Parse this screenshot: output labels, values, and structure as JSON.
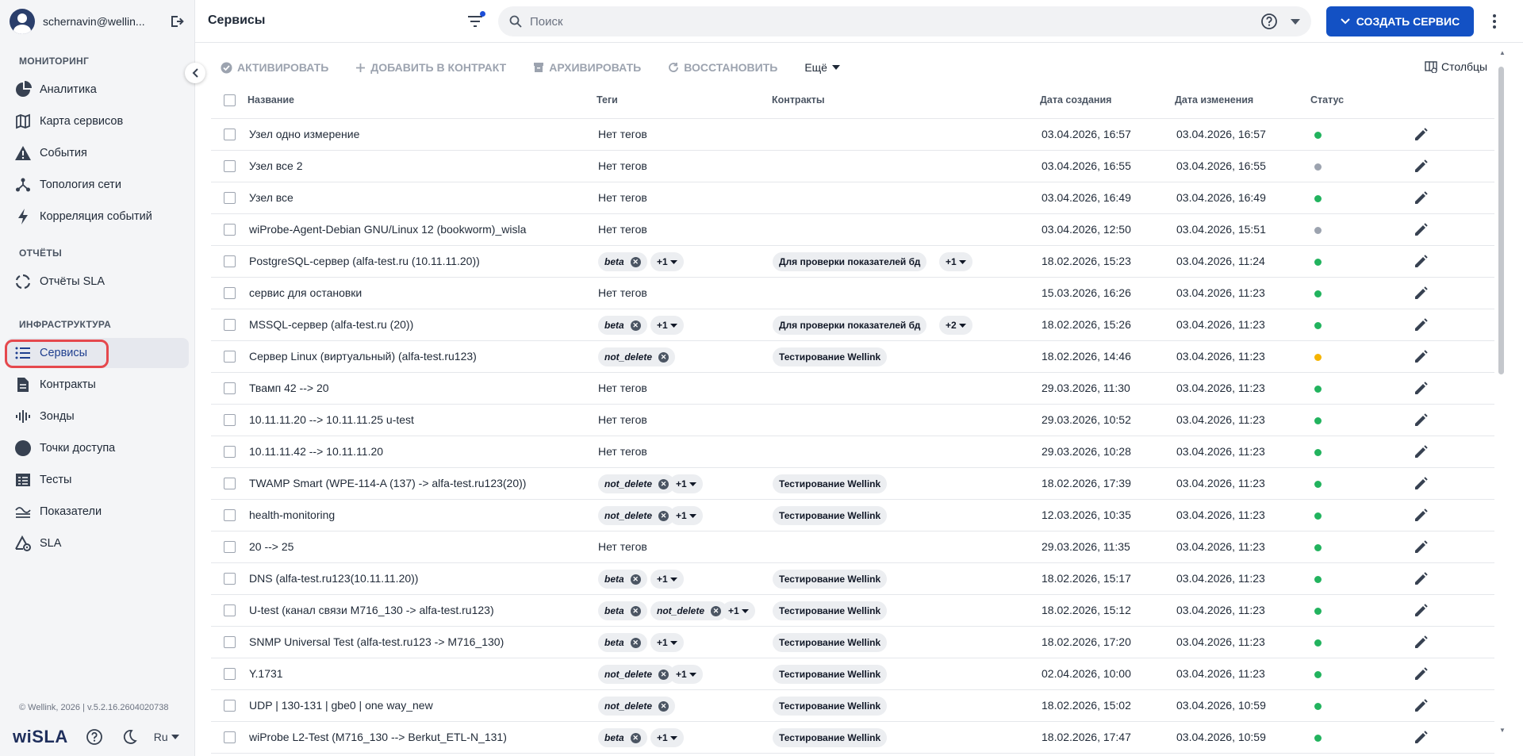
{
  "user": {
    "name": "schernavin@wellin..."
  },
  "sidebar": {
    "sections": [
      {
        "title": "МОНИТОРИНГ",
        "items": [
          {
            "label": "Аналитика",
            "icon": "analytics-icon"
          },
          {
            "label": "Карта сервисов",
            "icon": "map-icon"
          },
          {
            "label": "События",
            "icon": "warning-icon"
          },
          {
            "label": "Топология сети",
            "icon": "topology-icon"
          },
          {
            "label": "Корреляция событий",
            "icon": "bolt-icon"
          }
        ]
      },
      {
        "title": "ОТЧЁТЫ",
        "items": [
          {
            "label": "Отчёты SLA",
            "icon": "report-cycle-icon"
          }
        ]
      },
      {
        "title": "ИНФРАСТРУКТУРА",
        "items": [
          {
            "label": "Сервисы",
            "icon": "list-icon",
            "active": true
          },
          {
            "label": "Контракты",
            "icon": "document-icon"
          },
          {
            "label": "Зонды",
            "icon": "probe-icon"
          },
          {
            "label": "Точки доступа",
            "icon": "access-point-icon"
          },
          {
            "label": "Тесты",
            "icon": "tests-icon"
          },
          {
            "label": "Показатели",
            "icon": "metrics-icon"
          },
          {
            "label": "SLA",
            "icon": "sla-icon"
          }
        ]
      }
    ],
    "footer": {
      "copyright": "© Wellink, 2026 | v.5.2.16.2604020738",
      "logo": "wiSLA",
      "language": "Ru"
    }
  },
  "header": {
    "title": "Сервисы",
    "search_placeholder": "Поиск",
    "create_label": "СОЗДАТЬ СЕРВИС"
  },
  "toolbar": {
    "activate": "АКТИВИРОВАТЬ",
    "add_contract": "ДОБАВИТЬ В КОНТРАКТ",
    "archive": "АРХИВИРОВАТЬ",
    "restore": "ВОССТАНОВИТЬ",
    "more": "Ещё",
    "columns": "Столбцы"
  },
  "table": {
    "columns": [
      "Название",
      "Теги",
      "Контракты",
      "Дата создания",
      "Дата изменения",
      "Статус"
    ],
    "status_colors": {
      "green": "#22b35e",
      "gray": "#9ca3af",
      "yellow": "#f5b400"
    },
    "no_tags": "Нет тегов",
    "rows": [
      {
        "name": "Узел одно измерение",
        "tags": [],
        "tags_more": "",
        "contracts": [],
        "contracts_more": "",
        "created": "03.04.2026, 16:57",
        "modified": "03.04.2026, 16:57",
        "status": "green"
      },
      {
        "name": "Узел все 2",
        "tags": [],
        "tags_more": "",
        "contracts": [],
        "contracts_more": "",
        "created": "03.04.2026, 16:55",
        "modified": "03.04.2026, 16:55",
        "status": "gray"
      },
      {
        "name": "Узел все",
        "tags": [],
        "tags_more": "",
        "contracts": [],
        "contracts_more": "",
        "created": "03.04.2026, 16:49",
        "modified": "03.04.2026, 16:49",
        "status": "green"
      },
      {
        "name": "wiProbe-Agent-Debian GNU/Linux 12 (bookworm)_wisla",
        "tags": [],
        "tags_more": "",
        "contracts": [],
        "contracts_more": "",
        "created": "03.04.2026, 12:50",
        "modified": "03.04.2026, 15:51",
        "status": "gray"
      },
      {
        "name": "PostgreSQL-сервер (alfa-test.ru (10.11.11.20))",
        "tags": [
          "beta"
        ],
        "tags_more": "+1",
        "contracts": [
          "Для проверки показателей бд"
        ],
        "contracts_more": "+1",
        "created": "18.02.2026, 15:23",
        "modified": "03.04.2026, 11:24",
        "status": "green"
      },
      {
        "name": "сервис для остановки",
        "tags": [],
        "tags_more": "",
        "contracts": [],
        "contracts_more": "",
        "created": "15.03.2026, 16:26",
        "modified": "03.04.2026, 11:23",
        "status": "green"
      },
      {
        "name": "MSSQL-сервер (alfa-test.ru (20))",
        "tags": [
          "beta"
        ],
        "tags_more": "+1",
        "contracts": [
          "Для проверки показателей бд"
        ],
        "contracts_more": "+2",
        "created": "18.02.2026, 15:26",
        "modified": "03.04.2026, 11:23",
        "status": "green"
      },
      {
        "name": "Сервер Linux (виртуальный) (alfa-test.ru123)",
        "tags": [
          "not_delete"
        ],
        "tags_more": "",
        "contracts": [
          "Тестирование Wellink"
        ],
        "contracts_more": "",
        "created": "18.02.2026, 14:46",
        "modified": "03.04.2026, 11:23",
        "status": "yellow"
      },
      {
        "name": "Твамп 42 --> 20",
        "tags": [],
        "tags_more": "",
        "contracts": [],
        "contracts_more": "",
        "created": "29.03.2026, 11:30",
        "modified": "03.04.2026, 11:23",
        "status": "green"
      },
      {
        "name": "10.11.11.20 --> 10.11.11.25 u-test",
        "tags": [],
        "tags_more": "",
        "contracts": [],
        "contracts_more": "",
        "created": "29.03.2026, 10:52",
        "modified": "03.04.2026, 11:23",
        "status": "green"
      },
      {
        "name": "10.11.11.42 --> 10.11.11.20",
        "tags": [],
        "tags_more": "",
        "contracts": [],
        "contracts_more": "",
        "created": "29.03.2026, 10:28",
        "modified": "03.04.2026, 11:23",
        "status": "green"
      },
      {
        "name": "TWAMP Smart (WPE-114-A (137) -> alfa-test.ru123(20))",
        "tags": [
          "not_delete"
        ],
        "tags_more": "+1",
        "contracts": [
          "Тестирование Wellink"
        ],
        "contracts_more": "",
        "created": "18.02.2026, 17:39",
        "modified": "03.04.2026, 11:23",
        "status": "green"
      },
      {
        "name": "health-monitoring",
        "tags": [
          "not_delete"
        ],
        "tags_more": "+1",
        "contracts": [
          "Тестирование Wellink"
        ],
        "contracts_more": "",
        "created": "12.03.2026, 10:35",
        "modified": "03.04.2026, 11:23",
        "status": "green"
      },
      {
        "name": "20 --> 25",
        "tags": [],
        "tags_more": "",
        "contracts": [],
        "contracts_more": "",
        "created": "29.03.2026, 11:35",
        "modified": "03.04.2026, 11:23",
        "status": "green"
      },
      {
        "name": "DNS (alfa-test.ru123(10.11.11.20))",
        "tags": [
          "beta"
        ],
        "tags_more": "+1",
        "contracts": [
          "Тестирование Wellink"
        ],
        "contracts_more": "",
        "created": "18.02.2026, 15:17",
        "modified": "03.04.2026, 11:23",
        "status": "green"
      },
      {
        "name": "U-test (канал связи M716_130 -> alfa-test.ru123)",
        "tags": [
          "beta",
          "not_delete"
        ],
        "tags_more": "+1",
        "contracts": [
          "Тестирование Wellink"
        ],
        "contracts_more": "",
        "created": "18.02.2026, 15:12",
        "modified": "03.04.2026, 11:23",
        "status": "green"
      },
      {
        "name": "SNMP Universal Test (alfa-test.ru123 -> M716_130)",
        "tags": [
          "beta"
        ],
        "tags_more": "+1",
        "contracts": [
          "Тестирование Wellink"
        ],
        "contracts_more": "",
        "created": "18.02.2026, 17:20",
        "modified": "03.04.2026, 11:23",
        "status": "green"
      },
      {
        "name": "Y.1731",
        "tags": [
          "not_delete"
        ],
        "tags_more": "+1",
        "contracts": [
          "Тестирование Wellink"
        ],
        "contracts_more": "",
        "created": "02.04.2026, 10:00",
        "modified": "03.04.2026, 11:23",
        "status": "green"
      },
      {
        "name": "UDP | 130-131 | gbe0 | one way_new",
        "tags": [
          "not_delete"
        ],
        "tags_more": "",
        "contracts": [
          "Тестирование Wellink"
        ],
        "contracts_more": "",
        "created": "18.02.2026, 15:02",
        "modified": "03.04.2026, 10:59",
        "status": "green"
      },
      {
        "name": "wiProbe L2-Test (M716_130 --> Berkut_ETL-N_131)",
        "tags": [
          "beta"
        ],
        "tags_more": "+1",
        "contracts": [
          "Тестирование Wellink"
        ],
        "contracts_more": "",
        "created": "18.02.2026, 17:47",
        "modified": "03.04.2026, 10:59",
        "status": "green"
      }
    ]
  }
}
